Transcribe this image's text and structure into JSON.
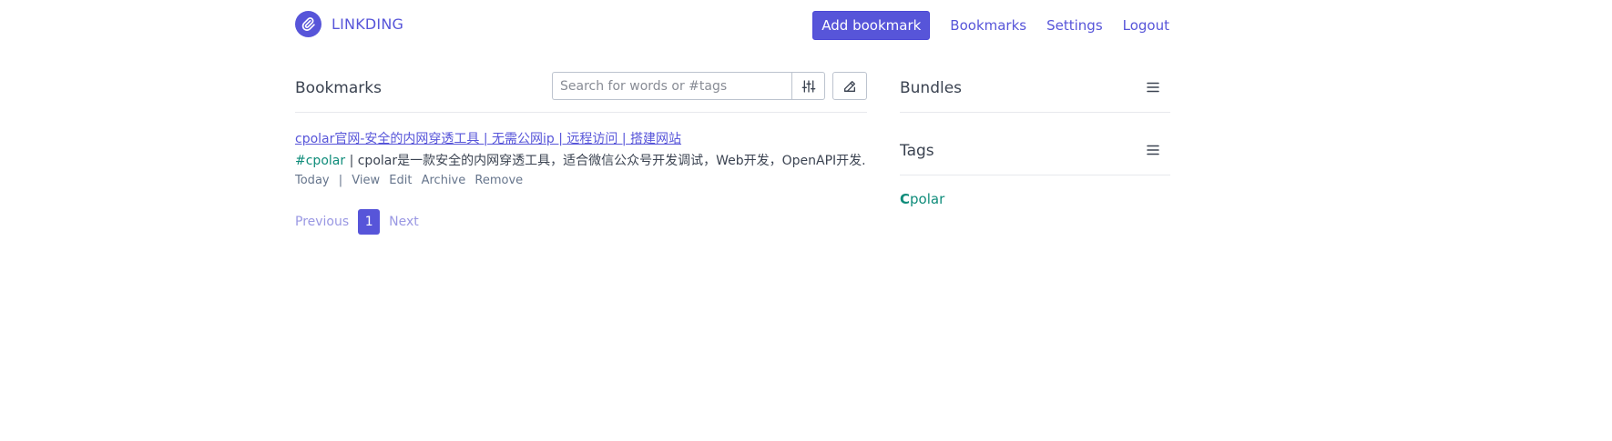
{
  "header": {
    "brand": "LINKDING",
    "add_label": "Add bookmark",
    "nav": [
      "Bookmarks",
      "Settings",
      "Logout"
    ]
  },
  "main": {
    "title": "Bookmarks",
    "search_placeholder": "Search for words or #tags",
    "bookmark": {
      "title": "cpolar官网-安全的内网穿透工具 | 无需公网ip | 远程访问 | 搭建网站",
      "tag": "#cpolar",
      "separator": "|",
      "description": "cpolar是一款安全的内网穿透工具，适合微信公众号开发调试，Web开发，OpenAPI开发...",
      "date": "Today",
      "actions": [
        "View",
        "Edit",
        "Archive",
        "Remove"
      ]
    },
    "pagination": {
      "previous": "Previous",
      "current": "1",
      "next": "Next"
    }
  },
  "sidebar": {
    "bundles_title": "Bundles",
    "tags_title": "Tags",
    "tag_first_letter": "C",
    "tag_rest": "polar"
  },
  "colors": {
    "primary": "#5755d9",
    "tag": "#0f8c7a",
    "text": "#3b4351",
    "muted": "#66758c"
  },
  "icons": [
    "paperclip-icon",
    "sliders-icon",
    "pencil-icon",
    "menu-icon"
  ]
}
